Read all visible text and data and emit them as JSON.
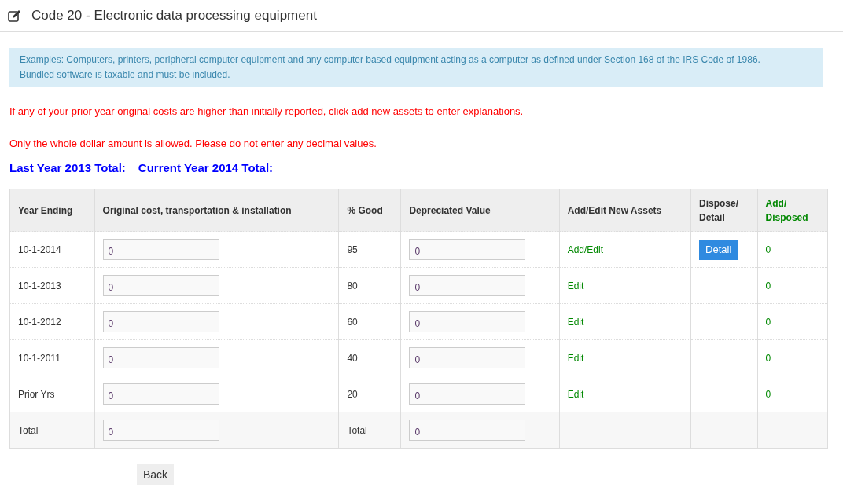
{
  "page_title": "Code 20 - Electronic data processing equipment",
  "info_box": [
    "Examples: Computers, printers, peripheral computer equipment and any computer based equipment acting as a computer as defined under Section 168 of the IRS Code of 1986.",
    "Bundled software is taxable and must be included."
  ],
  "warnings": [
    "If any of your prior year original costs are higher than initially reported, click add new assets to enter explanations.",
    "Only the whole dollar amount is allowed. Please do not enter any decimal values."
  ],
  "totals_heading": [
    "Last Year 2013 Total:",
    "Current Year 2014 Total:"
  ],
  "table": {
    "columns": [
      {
        "label": "Year Ending",
        "kind": "plain"
      },
      {
        "label": "Original cost, transportation & installation",
        "kind": "plain"
      },
      {
        "label": "% Good",
        "kind": "plain"
      },
      {
        "label": "Depreciated Value",
        "kind": "plain"
      },
      {
        "label": "Add/Edit New Assets",
        "kind": "plain"
      },
      {
        "label": "Dispose/ Detail",
        "kind": "plain"
      },
      {
        "label": "Add/ Disposed",
        "kind": "accent"
      }
    ],
    "rows": [
      {
        "kind": "entry",
        "year": "10-1-2014",
        "cost": "0",
        "good": "95",
        "depreciated": "0",
        "action": "Add/Edit",
        "detail": "Detail",
        "count": "0"
      },
      {
        "kind": "entry",
        "year": "10-1-2013",
        "cost": "0",
        "good": "80",
        "depreciated": "0",
        "action": "Edit",
        "count": "0"
      },
      {
        "kind": "entry",
        "year": "10-1-2012",
        "cost": "0",
        "good": "60",
        "depreciated": "0",
        "action": "Edit",
        "count": "0"
      },
      {
        "kind": "entry",
        "year": "10-1-2011",
        "cost": "0",
        "good": "40",
        "depreciated": "0",
        "action": "Edit",
        "count": "0"
      },
      {
        "kind": "entry",
        "year": "Prior Yrs",
        "cost": "0",
        "good": "20",
        "depreciated": "0",
        "action": "Edit",
        "count": "0"
      },
      {
        "kind": "total",
        "year": "Total",
        "cost": "0",
        "good": "Total",
        "depreciated": "0"
      }
    ]
  },
  "back_button": "Back"
}
